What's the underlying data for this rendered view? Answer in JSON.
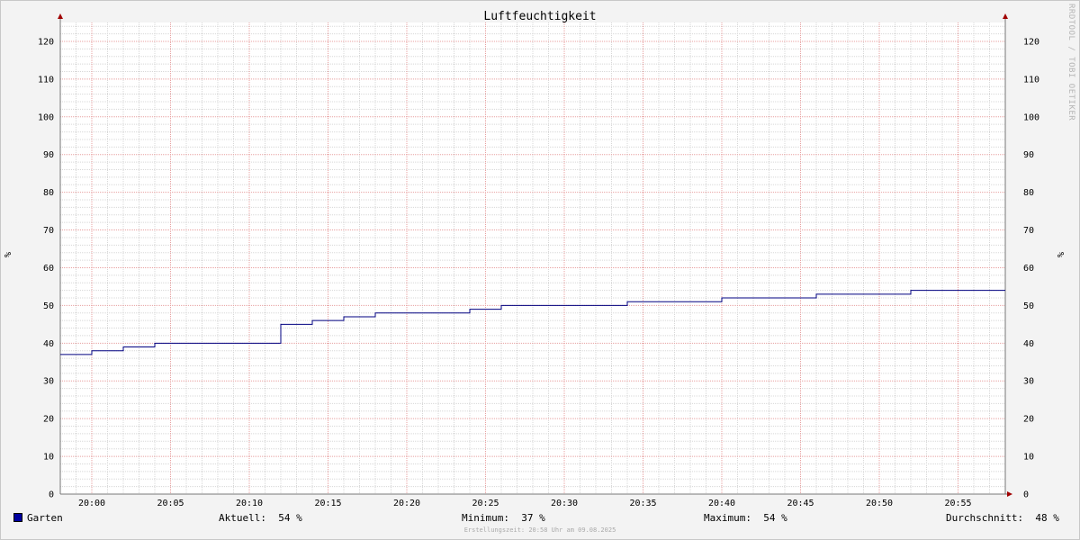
{
  "chart_data": {
    "type": "line",
    "title": "Luftfeuchtigkeit",
    "ylabel": "%",
    "ylim": [
      0,
      125
    ],
    "yticks": [
      0,
      10,
      20,
      30,
      40,
      50,
      60,
      70,
      80,
      90,
      100,
      110,
      120
    ],
    "xlim": [
      "19:58",
      "20:58"
    ],
    "xticks": [
      "20:00",
      "20:05",
      "20:10",
      "20:15",
      "20:20",
      "20:25",
      "20:30",
      "20:35",
      "20:40",
      "20:45",
      "20:50",
      "20:55"
    ],
    "grid": true,
    "series": [
      {
        "name": "Garten",
        "color": "#000080",
        "step": true,
        "points": [
          [
            "19:58",
            37
          ],
          [
            "20:00",
            38
          ],
          [
            "20:02",
            39
          ],
          [
            "20:04",
            40
          ],
          [
            "20:12",
            45
          ],
          [
            "20:14",
            46
          ],
          [
            "20:16",
            47
          ],
          [
            "20:18",
            48
          ],
          [
            "20:24",
            49
          ],
          [
            "20:26",
            50
          ],
          [
            "20:34",
            51
          ],
          [
            "20:40",
            52
          ],
          [
            "20:46",
            53
          ],
          [
            "20:52",
            54
          ],
          [
            "20:58",
            54
          ]
        ]
      }
    ]
  },
  "side_label": "RRDTOOL / TOBI OETIKER",
  "legend": {
    "series_name": "Garten",
    "swatch_color": "#0000a0",
    "current": "Aktuell:  54 %",
    "minimum": "Minimum:  37 %",
    "maximum": "Maximum:  54 %",
    "average": "Durchschnitt:  48 %"
  },
  "footer": "Erstellungszeit: 20:58 Uhr am 09.08.2025"
}
